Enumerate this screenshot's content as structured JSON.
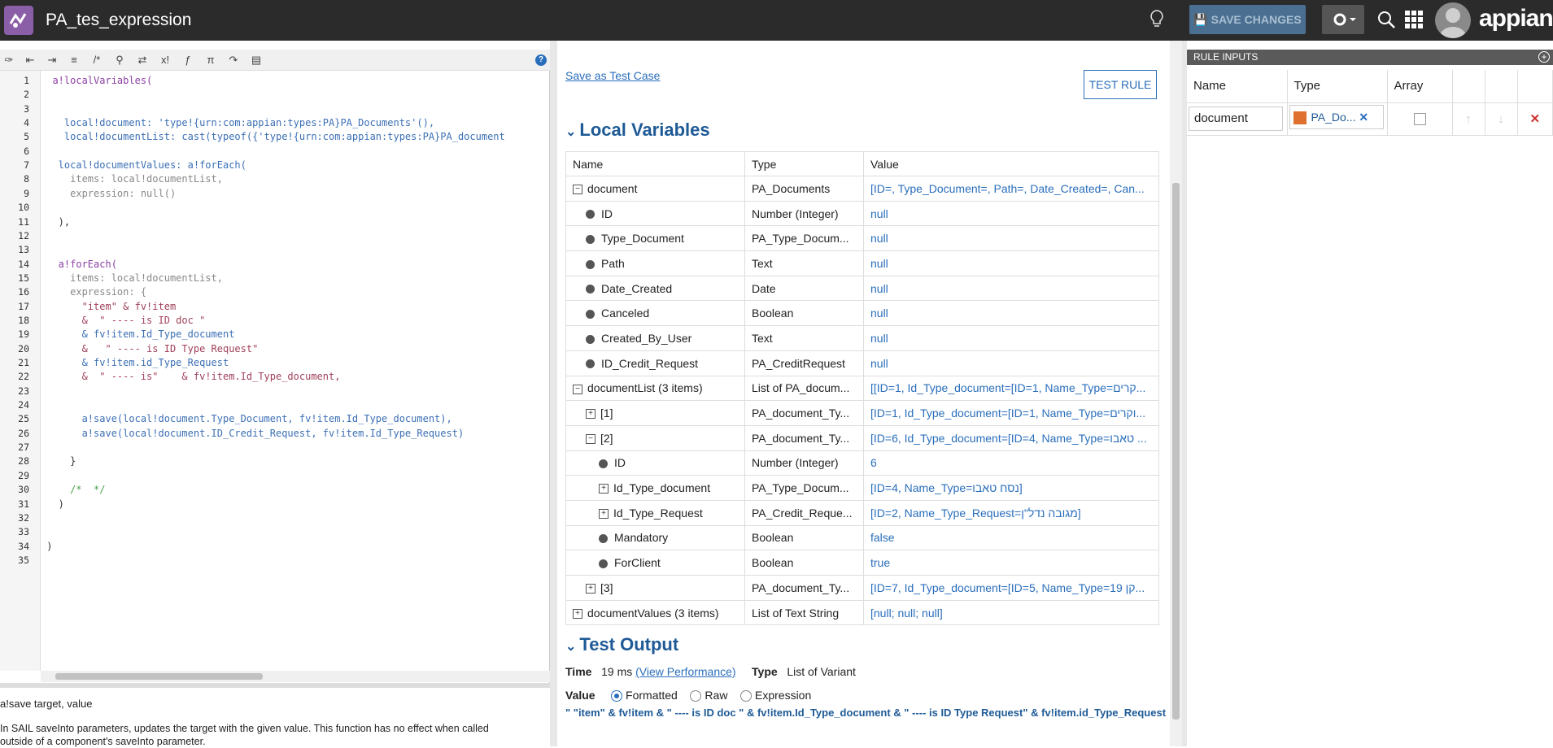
{
  "app": {
    "title": "PA_tes_expression",
    "save_label": "SAVE CHANGES",
    "brand": "appian"
  },
  "editor": {
    "help": "?",
    "lines": [
      "1",
      "2",
      "3",
      "4",
      "5",
      "6",
      "7",
      "8",
      "9",
      "10",
      "11",
      "12",
      "13",
      "14",
      "15",
      "16",
      "17",
      "18",
      "19",
      "20",
      "21",
      "22",
      "23",
      "24",
      "25",
      "26",
      "27",
      "28",
      "29",
      "30",
      "31",
      "32",
      "33",
      "34",
      "35"
    ],
    "code": [
      {
        "n": 1,
        "t": "  a!localVariables(",
        "c": "kw"
      },
      {
        "n": 4,
        "t": "    local!document: 'type!{urn:com:appian:types:PA}PA_Documents'(),",
        "c": "vr"
      },
      {
        "n": 5,
        "t": "    local!documentList: cast(typeof({'type!{urn:com:appian:types:PA}PA_document",
        "c": "vr"
      },
      {
        "n": 7,
        "t": "   local!documentValues: a!forEach(",
        "c": "vr"
      },
      {
        "n": 8,
        "t": "     items: local!documentList,",
        "c": "gy"
      },
      {
        "n": 9,
        "t": "     expression: null()",
        "c": "gy"
      },
      {
        "n": 11,
        "t": "   ),",
        "c": ""
      },
      {
        "n": 14,
        "t": "   a!forEach(",
        "c": "kw"
      },
      {
        "n": 15,
        "t": "     items: local!documentList,",
        "c": "gy"
      },
      {
        "n": 16,
        "t": "     expression: {",
        "c": "gy"
      },
      {
        "n": 17,
        "t": "       \"item\" & fv!item",
        "c": "st"
      },
      {
        "n": 18,
        "t": "       &  \" ---- is ID doc \"",
        "c": "st"
      },
      {
        "n": 19,
        "t": "       & fv!item.Id_Type_document",
        "c": "vr"
      },
      {
        "n": 20,
        "t": "       &   \" ---- is ID Type Request\"",
        "c": "st"
      },
      {
        "n": 21,
        "t": "       & fv!item.id_Type_Request",
        "c": "vr"
      },
      {
        "n": 22,
        "t": "       &  \" ---- is\"    & fv!item.Id_Type_document,",
        "c": "st"
      },
      {
        "n": 25,
        "t": "       a!save(local!document.Type_Document, fv!item.Id_Type_document),",
        "c": "vr"
      },
      {
        "n": 26,
        "t": "       a!save(local!document.ID_Credit_Request, fv!item.Id_Type_Request)",
        "c": "vr"
      },
      {
        "n": 28,
        "t": "     }",
        "c": ""
      },
      {
        "n": 30,
        "t": "     /*  */",
        "c": "cm"
      },
      {
        "n": 31,
        "t": "   )",
        "c": ""
      },
      {
        "n": 34,
        "t": " )",
        "c": ""
      }
    ],
    "doc_sig": "a!save  target, value",
    "doc_desc": "In SAIL saveInto parameters, updates the target with the given value. This function has no effect when called outside of a component's saveInto parameter."
  },
  "middle": {
    "save_test_case": "Save as Test Case",
    "test_rule": "TEST RULE",
    "local_vars_title": "Local Variables",
    "headers": [
      "Name",
      "Type",
      "Value"
    ],
    "rows": [
      {
        "ind": 0,
        "mark": "minus",
        "name": "document",
        "type": "PA_Documents",
        "value": "[ID=, Type_Document=, Path=, Date_Created=, Can..."
      },
      {
        "ind": 1,
        "mark": "dot",
        "name": "ID",
        "type": "Number (Integer)",
        "value": "null"
      },
      {
        "ind": 1,
        "mark": "dot",
        "name": "Type_Document",
        "type": "PA_Type_Docum...",
        "value": "null"
      },
      {
        "ind": 1,
        "mark": "dot",
        "name": "Path",
        "type": "Text",
        "value": "null"
      },
      {
        "ind": 1,
        "mark": "dot",
        "name": "Date_Created",
        "type": "Date",
        "value": "null"
      },
      {
        "ind": 1,
        "mark": "dot",
        "name": "Canceled",
        "type": "Boolean",
        "value": "null"
      },
      {
        "ind": 1,
        "mark": "dot",
        "name": "Created_By_User",
        "type": "Text",
        "value": "null"
      },
      {
        "ind": 1,
        "mark": "dot",
        "name": "ID_Credit_Request",
        "type": "PA_CreditRequest",
        "value": "null"
      },
      {
        "ind": 0,
        "mark": "minus",
        "name": "documentList (3 items)",
        "type": "List of PA_docum...",
        "value": "[[ID=1, Id_Type_document=[ID=1, Name_Type=קרים..."
      },
      {
        "ind": 1,
        "mark": "plus",
        "name": "[1]",
        "type": "PA_document_Ty...",
        "value": "[ID=1, Id_Type_document=[ID=1, Name_Type=וקרים..."
      },
      {
        "ind": 1,
        "mark": "minus",
        "name": "[2]",
        "type": "PA_document_Ty...",
        "value": "[ID=6, Id_Type_document=[ID=4, Name_Type=טאבו ..."
      },
      {
        "ind": 2,
        "mark": "dot",
        "name": "ID",
        "type": "Number (Integer)",
        "value": "6"
      },
      {
        "ind": 2,
        "mark": "plus",
        "name": "Id_Type_document",
        "type": "PA_Type_Docum...",
        "value": "[ID=4, Name_Type=נסח טאבו]"
      },
      {
        "ind": 2,
        "mark": "plus",
        "name": "Id_Type_Request",
        "type": "PA_Credit_Reque...",
        "value": "[ID=2, Name_Type_Request=מגובה נדל\"ן]"
      },
      {
        "ind": 2,
        "mark": "dot",
        "name": "Mandatory",
        "type": "Boolean",
        "value": "false"
      },
      {
        "ind": 2,
        "mark": "dot",
        "name": "ForClient",
        "type": "Boolean",
        "value": "true"
      },
      {
        "ind": 1,
        "mark": "plus",
        "name": "[3]",
        "type": "PA_document_Ty...",
        "value": "[ID=7, Id_Type_document=[ID=5, Name_Type=19 קן..."
      },
      {
        "ind": 0,
        "mark": "plus",
        "name": "documentValues (3 items)",
        "type": "List of Text String",
        "value": "[null; null; null]"
      }
    ],
    "test_output_title": "Test Output",
    "time_label": "Time",
    "time_value": "19 ms",
    "view_perf": "(View Performance)",
    "type_label": "Type",
    "type_value": "List of Variant",
    "value_label": "Value",
    "opt_formatted": "Formatted",
    "opt_raw": "Raw",
    "opt_expression": "Expression",
    "output_value": "\" \"item\" & fv!item & \" ---- is ID doc \" & fv!item.Id_Type_document & \" ---- is ID Type Request\" & fv!item.id_Type_Request"
  },
  "rule_inputs": {
    "title": "RULE INPUTS",
    "headers": [
      "Name",
      "Type",
      "Array"
    ],
    "name": "document",
    "type": "PA_Do..."
  }
}
